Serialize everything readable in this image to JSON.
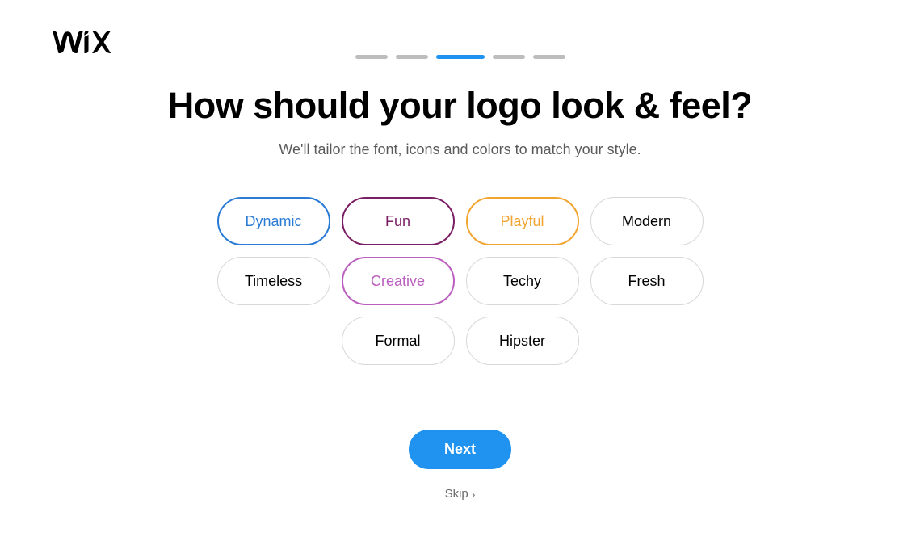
{
  "progress": {
    "current": 3,
    "total": 5
  },
  "heading": "How should your logo look & feel?",
  "subtitle": "We'll tailor the font, icons and colors to match your style.",
  "options": {
    "dynamic": {
      "label": "Dynamic",
      "selected": true
    },
    "fun": {
      "label": "Fun",
      "selected": true
    },
    "playful": {
      "label": "Playful",
      "selected": true
    },
    "modern": {
      "label": "Modern",
      "selected": false
    },
    "timeless": {
      "label": "Timeless",
      "selected": false
    },
    "creative": {
      "label": "Creative",
      "selected": true
    },
    "techy": {
      "label": "Techy",
      "selected": false
    },
    "fresh": {
      "label": "Fresh",
      "selected": false
    },
    "formal": {
      "label": "Formal",
      "selected": false
    },
    "hipster": {
      "label": "Hipster",
      "selected": false
    }
  },
  "actions": {
    "next": "Next",
    "skip": "Skip"
  }
}
